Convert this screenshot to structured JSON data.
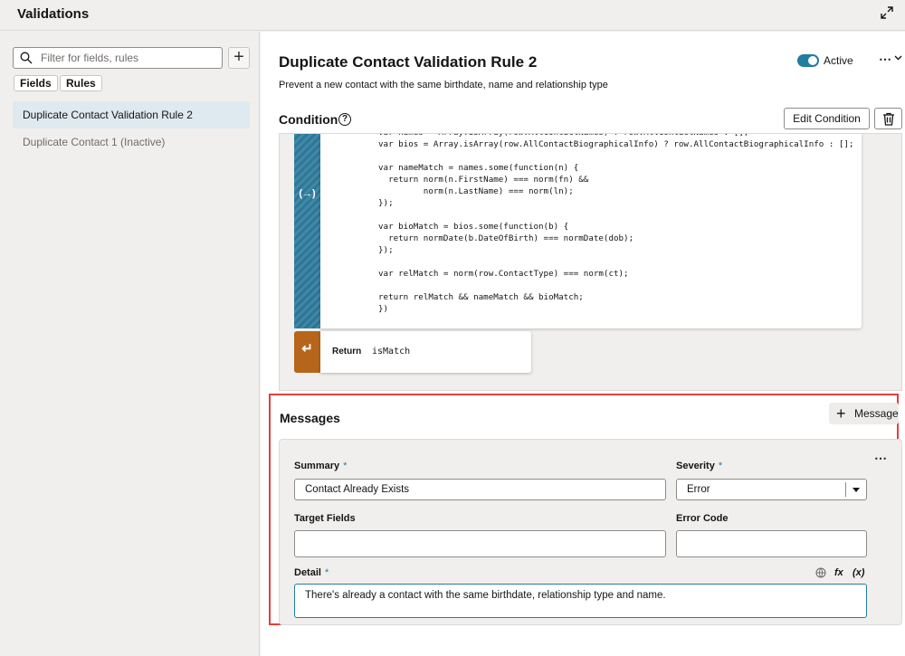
{
  "header": {
    "title": "Validations"
  },
  "sidebar": {
    "filter_placeholder": "Filter for fields, rules",
    "add_label": "+",
    "chips": [
      "Fields",
      "Rules"
    ],
    "items": [
      {
        "label": "Duplicate Contact Validation Rule 2",
        "selected": true
      },
      {
        "label": "Duplicate Contact 1 (Inactive)",
        "selected": false
      }
    ]
  },
  "rule": {
    "title": "Duplicate Contact Validation Rule 2",
    "description": "Prevent a new contact with the same birthdate, name and relationship type",
    "active_label": "Active",
    "more_label": "⋯"
  },
  "condition": {
    "heading": "Condition",
    "help": "?",
    "edit_label": "Edit Condition",
    "code_icon": "(→)",
    "code": "var names = Array.isArray(row.AllContactNames) ? row.AllContactNames : [];\nvar bios = Array.isArray(row.AllContactBiographicalInfo) ? row.AllContactBiographicalInfo : [];\n\nvar nameMatch = names.some(function(n) {\n  return norm(n.FirstName) === norm(fn) &&\n         norm(n.LastName) === norm(ln);\n});\n\nvar bioMatch = bios.some(function(b) {\n  return normDate(b.DateOfBirth) === normDate(dob);\n});\n\nvar relMatch = norm(row.ContactType) === norm(ct);\n\nreturn relMatch && nameMatch && bioMatch;\n})",
    "return_icon": "↵",
    "return_label": "Return",
    "return_value": "isMatch"
  },
  "messages": {
    "heading": "Messages",
    "add_label": "Message",
    "more_label": "⋯",
    "summary_label": "Summary",
    "summary_value": "Contact Already Exists",
    "severity_label": "Severity",
    "severity_value": "Error",
    "target_label": "Target Fields",
    "target_value": "",
    "error_code_label": "Error Code",
    "error_code_value": "",
    "detail_label": "Detail",
    "detail_value": "There's already a contact with the same birthdate, relationship type and name.",
    "fx_label": "fx",
    "var_label": "(x)",
    "required_mark": "*"
  },
  "colors": {
    "accent": "#227e9e",
    "code_bar": "#3f88a6",
    "return_bar": "#b7651b",
    "highlight": "#e0403f"
  }
}
